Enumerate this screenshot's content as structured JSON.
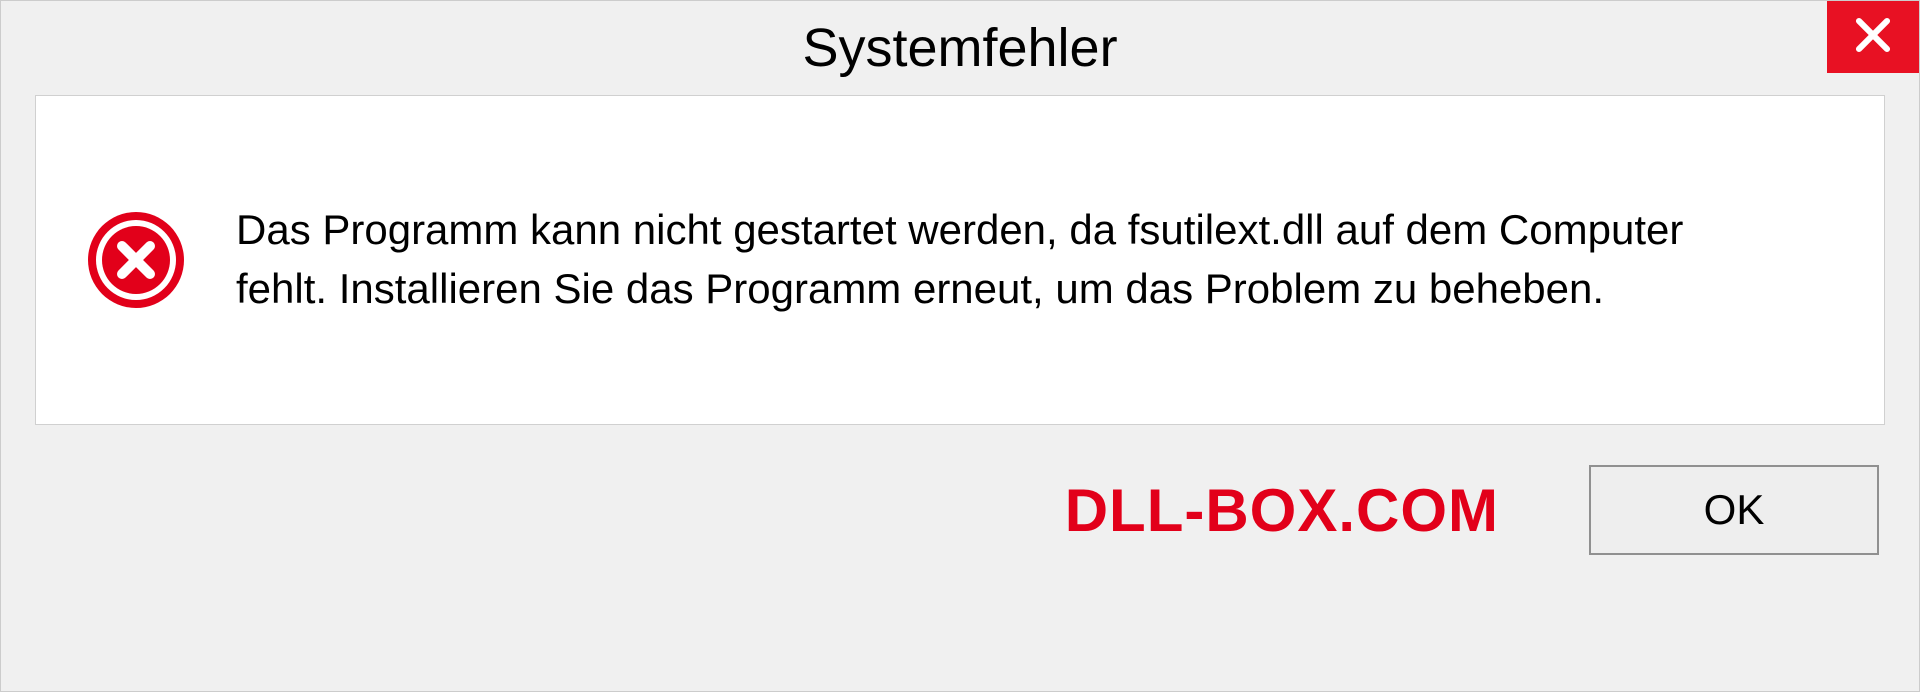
{
  "dialog": {
    "title": "Systemfehler",
    "message": "Das Programm kann nicht gestartet werden, da fsutilext.dll auf dem Computer fehlt. Installieren Sie das Programm erneut, um das Problem zu beheben.",
    "ok_label": "OK",
    "watermark": "DLL-BOX.COM"
  }
}
